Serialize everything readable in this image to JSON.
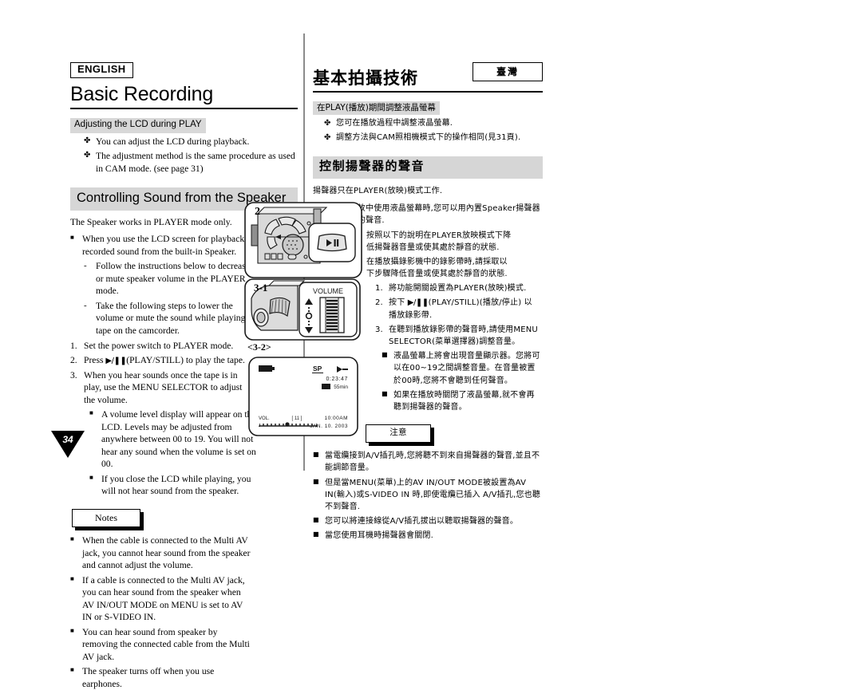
{
  "english": {
    "lang_badge": "ENGLISH",
    "chapter_title": "Basic Recording",
    "section_lcd": {
      "heading": "Adjusting the LCD during PLAY",
      "bullets": [
        "You can adjust the LCD during playback.",
        "The adjustment method is the same procedure as used in CAM mode. (see page 31)"
      ]
    },
    "section_speaker": {
      "heading": "Controlling Sound from the Speaker",
      "lead": "The Speaker works in PLAYER mode only.",
      "bullet_main": "When you use the LCD screen for playback, you can hear recorded sound from the built-in Speaker.",
      "dashes": [
        "Follow the instructions below to decrease or mute speaker volume in the PLAYER mode.",
        "Take the following steps to lower the volume or mute the sound while playing a tape on the camcorder."
      ],
      "steps": [
        {
          "num": "1.",
          "text": "Set the power switch to PLAYER mode."
        },
        {
          "num": "2.",
          "text": "Press  (PLAY/STILL) to play the tape.",
          "has_play_glyph": true
        },
        {
          "num": "3.",
          "text": "When you hear sounds once the tape is in play, use the MENU SELECTOR to adjust the volume."
        }
      ],
      "substeps": [
        "A volume level display will appear on the LCD. Levels may be adjusted from anywhere between 00 to 19. You will not hear any sound when the volume is set on 00.",
        "If you close the LCD while playing, you will not hear sound from the speaker."
      ]
    },
    "notes": {
      "label": "Notes",
      "items": [
        "When the cable is connected to the Multi AV jack, you cannot hear sound from the speaker and cannot adjust the volume.",
        "If a cable is connected to the Multi AV jack, you can hear sound from the speaker when AV IN/OUT MODE on MENU is set to AV IN or S-VIDEO IN.",
        "You can hear sound from speaker by removing the connected cable from the Multi AV jack.",
        "The speaker turns off when you use earphones."
      ]
    }
  },
  "chinese": {
    "region_badge": "臺灣",
    "chapter_title": "基本拍攝技術",
    "section_lcd": {
      "heading": "在PLAY(播放)期間調整液晶螢幕",
      "bullets": [
        "您可在播放過程中調整液晶螢幕.",
        "調整方法與CAM照相機模式下的操作相同(見31頁)."
      ]
    },
    "section_speaker": {
      "heading": "控制揚聲器的聲音",
      "lead": "揚聲器只在PLAYER(放映)模式工作.",
      "bullet_main": "當您在播放中使用液晶螢幕時,您可以用內置Speaker揚聲器聽取錄製的聲音.",
      "dashes": [
        "按照以下的說明在PLAYER放映模式下降低揚聲器音量或使其處於靜音的狀態.",
        "在播放攝錄影機中的錄影帶時,請採取以下步驟降低音量或使其處於靜音的狀態."
      ],
      "steps": [
        {
          "num": "1.",
          "text": "將功能開關設置為PLAYER(放映)模式."
        },
        {
          "num": "2.",
          "text": "按下 (PLAY/STILL)(播放/停止) 以播放錄影帶.",
          "has_play_glyph": true
        },
        {
          "num": "3.",
          "text": "在聽到播放錄影帶的聲音時,請使用MENU SELECTOR(菜單選擇器)調整音量。"
        }
      ],
      "substeps": [
        "液晶螢幕上將會出現音量顯示器。您將可以在00~19之間調整音量。在音量被置於00時,您將不會聽到任何聲音。",
        "如果在播放時關閉了液晶螢幕,就不會再聽到揚聲器的聲音。"
      ]
    },
    "notes": {
      "label": "注意",
      "items": [
        "當電纜接到A/V插孔時,您將聽不到來自揚聲器的聲音,並且不能調節音量。",
        "但是當MENU(菜單)上的AV IN/OUT MODE被設置為AV IN(輸入)或S-VIDEO IN 時,即使電纜已插入 A/V插孔,您也聽不到聲音.",
        "您可以將連接線從A/V插孔拔出以聽取揚聲器的聲音。",
        "當您使用耳機時揚聲器會關閉."
      ]
    }
  },
  "figures": {
    "fig2": {
      "label": "2",
      "callout_button": "/"
    },
    "fig31": {
      "label": "3-1",
      "volume_label": "VOLUME"
    },
    "fig32": {
      "label": "<3-2>",
      "osd": {
        "mode": "SP",
        "timecode": "0:23:47",
        "tape_remaining": "55min",
        "vol_label": "VOL.",
        "vol_value": "[ 11 ]",
        "time": "10:00AM",
        "date": "JAN. 10. 2003"
      }
    }
  },
  "markers": {
    "club": "✤",
    "square": "■",
    "dash": "-"
  },
  "page_number": "34",
  "colors": {
    "bar_grey": "#d6d6d6",
    "divider_grey": "#8b8b8b",
    "ink": "#000000"
  }
}
